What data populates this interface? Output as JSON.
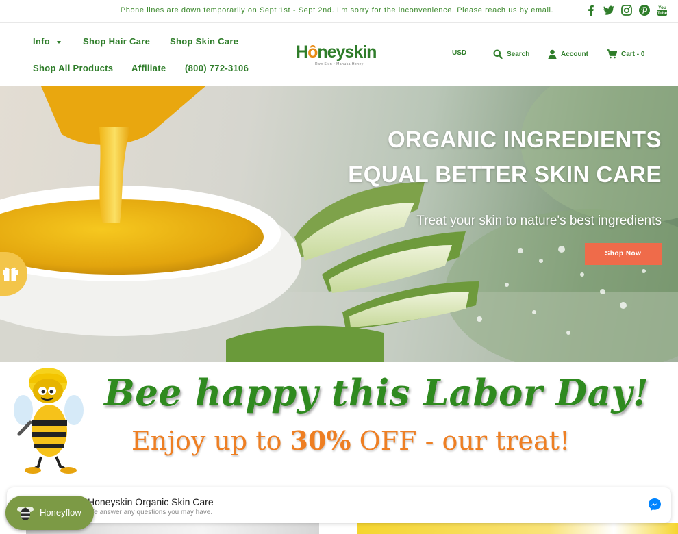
{
  "announcement": {
    "text": "Phone lines are down temporarily on Sept 1st - Sept 2nd. I'm sorry for the inconvenience. Please reach us by email."
  },
  "social": [
    "facebook-icon",
    "twitter-icon",
    "instagram-icon",
    "pinterest-icon",
    "youtube-icon"
  ],
  "header": {
    "nav": {
      "info": "Info",
      "hair": "Shop Hair Care",
      "skin": "Shop Skin Care",
      "all": "Shop All Products",
      "affiliate": "Affiliate",
      "phone": "(800) 772-3106"
    },
    "logo": {
      "part1": "H",
      "part2": "neyskin",
      "tagline": "Raw Skin • Manuka Honey"
    },
    "currency": "USD",
    "search": "Search",
    "account": "Account",
    "cart": "Cart - 0"
  },
  "hero": {
    "line1": "ORGANIC INGREDIENTS",
    "line2": "EQUAL BETTER SKIN CARE",
    "subtitle": "Treat your skin to nature's best ingredients",
    "button": "Shop Now"
  },
  "promo": {
    "line1": "Bee happy this Labor Day!",
    "line2_pre": "Enjoy up to ",
    "line2_pct": "30%",
    "line2_post": " OFF - our treat!"
  },
  "messenger": {
    "title": "Honeyskin Organic Skin Care",
    "subtitle": "We answer any questions you may have."
  },
  "honeyflow": {
    "label": "Honeyflow"
  },
  "colors": {
    "brand_green": "#2f7d2a",
    "accent_orange": "#ef6b4a",
    "honey": "#f3c54a",
    "messenger_blue": "#0084ff"
  }
}
